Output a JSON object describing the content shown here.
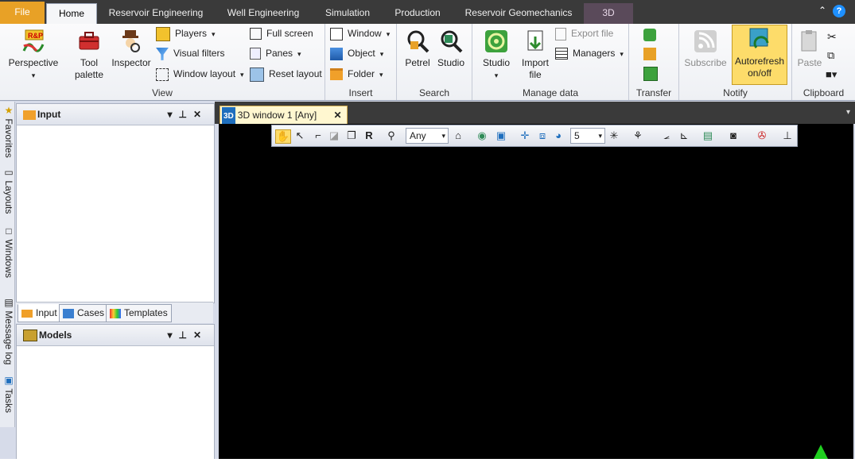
{
  "tabs": [
    "File",
    "Home",
    "Reservoir Engineering",
    "Well Engineering",
    "Simulation",
    "Production",
    "Reservoir Geomechanics",
    "3D"
  ],
  "help_label": "?",
  "ribbon": {
    "view": {
      "label": "View",
      "perspective": "Perspective",
      "tool_palette_1": "Tool",
      "tool_palette_2": "palette",
      "inspector": "Inspector",
      "players": "Players",
      "visual_filters": "Visual filters",
      "window_layout": "Window layout",
      "full_screen": "Full screen",
      "panes": "Panes",
      "reset_layout": "Reset layout"
    },
    "insert": {
      "label": "Insert",
      "window": "Window",
      "object": "Object",
      "folder": "Folder"
    },
    "search": {
      "label": "Search",
      "petrel": "Petrel",
      "studio": "Studio"
    },
    "manage": {
      "label": "Manage data",
      "studio": "Studio",
      "import_1": "Import",
      "import_2": "file",
      "export_file": "Export file",
      "managers": "Managers"
    },
    "transfer": {
      "label": "Transfer"
    },
    "notify": {
      "label": "Notify",
      "subscribe": "Subscribe",
      "autorefresh_1": "Autorefresh",
      "autorefresh_2": "on/off"
    },
    "clipboard": {
      "label": "Clipboard",
      "paste": "Paste"
    }
  },
  "left_tabs": [
    "Favorites",
    "Layouts",
    "Windows",
    "Message log",
    "Tasks"
  ],
  "input_pane": {
    "title": "Input",
    "tabs": [
      "Input",
      "Cases",
      "Templates"
    ]
  },
  "models_pane": {
    "title": "Models"
  },
  "window3d": {
    "tab_label": "3D window 1 [Any]",
    "icon_text": "3D",
    "filter_value": "Any",
    "number_value": "5"
  },
  "colors": {
    "file_tab": "#e8a126",
    "viewport": "#000000",
    "accent": "#1e90ff"
  }
}
